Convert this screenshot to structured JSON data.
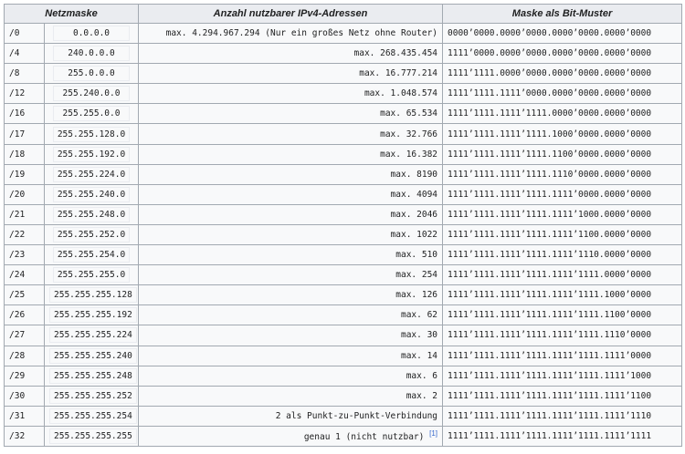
{
  "headers": {
    "mask": "Netzmaske",
    "count": "Anzahl nutzbarer IPv4-Adressen",
    "bits": "Maske als Bit-Muster"
  },
  "rows": [
    {
      "prefix": "/0",
      "mask": "0.0.0.0",
      "count": "max. 4.294.967.294 (Nur ein großes Netz ohne Router)",
      "bits": "0000’0000.0000’0000.0000’0000.0000’0000"
    },
    {
      "prefix": "/4",
      "mask": "240.0.0.0",
      "count": "max. 268.435.454",
      "bits": "1111’0000.0000’0000.0000’0000.0000’0000"
    },
    {
      "prefix": "/8",
      "mask": "255.0.0.0",
      "count": "max. 16.777.214",
      "bits": "1111’1111.0000’0000.0000’0000.0000’0000"
    },
    {
      "prefix": "/12",
      "mask": "255.240.0.0",
      "count": "max. 1.048.574",
      "bits": "1111’1111.1111’0000.0000’0000.0000’0000"
    },
    {
      "prefix": "/16",
      "mask": "255.255.0.0",
      "count": "max. 65.534",
      "bits": "1111’1111.1111’1111.0000’0000.0000’0000"
    },
    {
      "prefix": "/17",
      "mask": "255.255.128.0",
      "count": "max. 32.766",
      "bits": "1111’1111.1111’1111.1000’0000.0000’0000"
    },
    {
      "prefix": "/18",
      "mask": "255.255.192.0",
      "count": "max. 16.382",
      "bits": "1111’1111.1111’1111.1100’0000.0000’0000"
    },
    {
      "prefix": "/19",
      "mask": "255.255.224.0",
      "count": "max. 8190",
      "bits": "1111’1111.1111’1111.1110’0000.0000’0000"
    },
    {
      "prefix": "/20",
      "mask": "255.255.240.0",
      "count": "max. 4094",
      "bits": "1111’1111.1111’1111.1111’0000.0000’0000"
    },
    {
      "prefix": "/21",
      "mask": "255.255.248.0",
      "count": "max. 2046",
      "bits": "1111’1111.1111’1111.1111’1000.0000’0000"
    },
    {
      "prefix": "/22",
      "mask": "255.255.252.0",
      "count": "max. 1022",
      "bits": "1111’1111.1111’1111.1111’1100.0000’0000"
    },
    {
      "prefix": "/23",
      "mask": "255.255.254.0",
      "count": "max. 510",
      "bits": "1111’1111.1111’1111.1111’1110.0000’0000"
    },
    {
      "prefix": "/24",
      "mask": "255.255.255.0",
      "count": "max. 254",
      "bits": "1111’1111.1111’1111.1111’1111.0000’0000"
    },
    {
      "prefix": "/25",
      "mask": "255.255.255.128",
      "count": "max. 126",
      "bits": "1111’1111.1111’1111.1111’1111.1000’0000"
    },
    {
      "prefix": "/26",
      "mask": "255.255.255.192",
      "count": "max. 62",
      "bits": "1111’1111.1111’1111.1111’1111.1100’0000"
    },
    {
      "prefix": "/27",
      "mask": "255.255.255.224",
      "count": "max. 30",
      "bits": "1111’1111.1111’1111.1111’1111.1110’0000"
    },
    {
      "prefix": "/28",
      "mask": "255.255.255.240",
      "count": "max. 14",
      "bits": "1111’1111.1111’1111.1111’1111.1111’0000"
    },
    {
      "prefix": "/29",
      "mask": "255.255.255.248",
      "count": "max. 6",
      "bits": "1111’1111.1111’1111.1111’1111.1111’1000"
    },
    {
      "prefix": "/30",
      "mask": "255.255.255.252",
      "count": "max. 2",
      "bits": "1111’1111.1111’1111.1111’1111.1111’1100"
    },
    {
      "prefix": "/31",
      "mask": "255.255.255.254",
      "count": "2 als Punkt-zu-Punkt-Verbindung",
      "bits": "1111’1111.1111’1111.1111’1111.1111’1110"
    },
    {
      "prefix": "/32",
      "mask": "255.255.255.255",
      "count": "genau 1 (nicht nutzbar)",
      "ref": "[1]",
      "bits": "1111’1111.1111’1111.1111’1111.1111’1111"
    }
  ]
}
